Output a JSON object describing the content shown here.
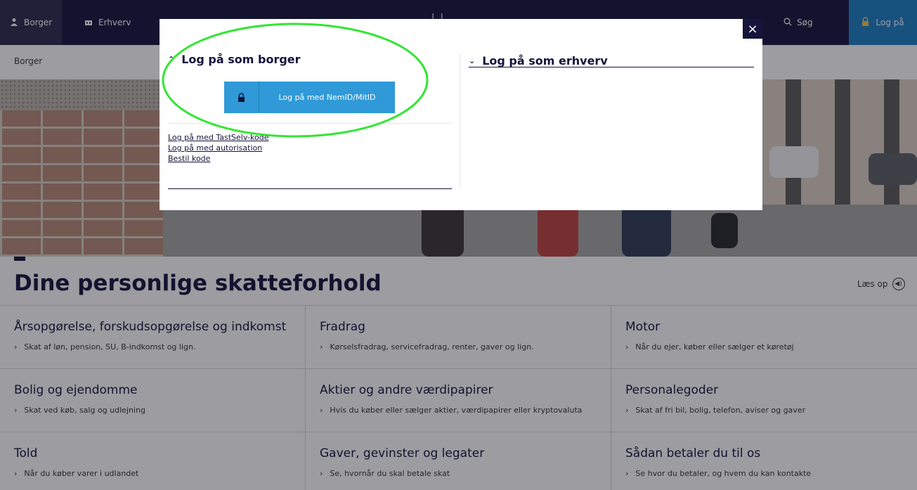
{
  "nav": {
    "tabs": [
      {
        "label": "Borger",
        "icon": "person-icon"
      },
      {
        "label": "Erhverv",
        "icon": "building-icon"
      }
    ],
    "search_label": "Søg",
    "login_label": "Log på"
  },
  "breadcrumb": "Borger",
  "section": {
    "heading": "Dine personlige skatteforhold",
    "read_aloud": "Læs op",
    "rows": [
      [
        {
          "title": "Årsopgørelse, forskudsopgørelse og indkomst",
          "sub": "Skat af løn, pension, SU, B-indkomst og lign."
        },
        {
          "title": "Fradrag",
          "sub": "Kørselsfradrag, servicefradrag, renter, gaver og lign."
        },
        {
          "title": "Motor",
          "sub": "Når du ejer, køber eller sælger et køretøj"
        }
      ],
      [
        {
          "title": "Bolig og ejendomme",
          "sub": "Skat ved køb, salg og udlejning"
        },
        {
          "title": "Aktier og andre værdipapirer",
          "sub": "Hvis du køber eller sælger aktier, værdipapirer eller kryptovaluta"
        },
        {
          "title": "Personalegoder",
          "sub": "Skat af fri bil, bolig, telefon, aviser og gaver"
        }
      ],
      [
        {
          "title": "Told",
          "sub": "Når du køber varer i udlandet"
        },
        {
          "title": "Gaver, gevinster og legater",
          "sub": "Se, hvornår du skal betale skat"
        },
        {
          "title": "Sådan betaler du til os",
          "sub": "Se hvor du betaler, og hvem du kan kontakte"
        }
      ]
    ]
  },
  "modal": {
    "close_label": "×",
    "borger": {
      "title": "Log på som borger",
      "nemid_label": "Log på med NemID/MitID",
      "links": [
        "Log på med TastSelv-kode",
        "Log på med autorisation",
        "Bestil kode"
      ]
    },
    "erhverv": {
      "title": "Log på som erhverv"
    }
  },
  "colors": {
    "navy": "#14143c",
    "login_blue": "#1a7ec3",
    "nemid_blue": "#2f9ad7",
    "highlight_ring": "#33e633"
  }
}
